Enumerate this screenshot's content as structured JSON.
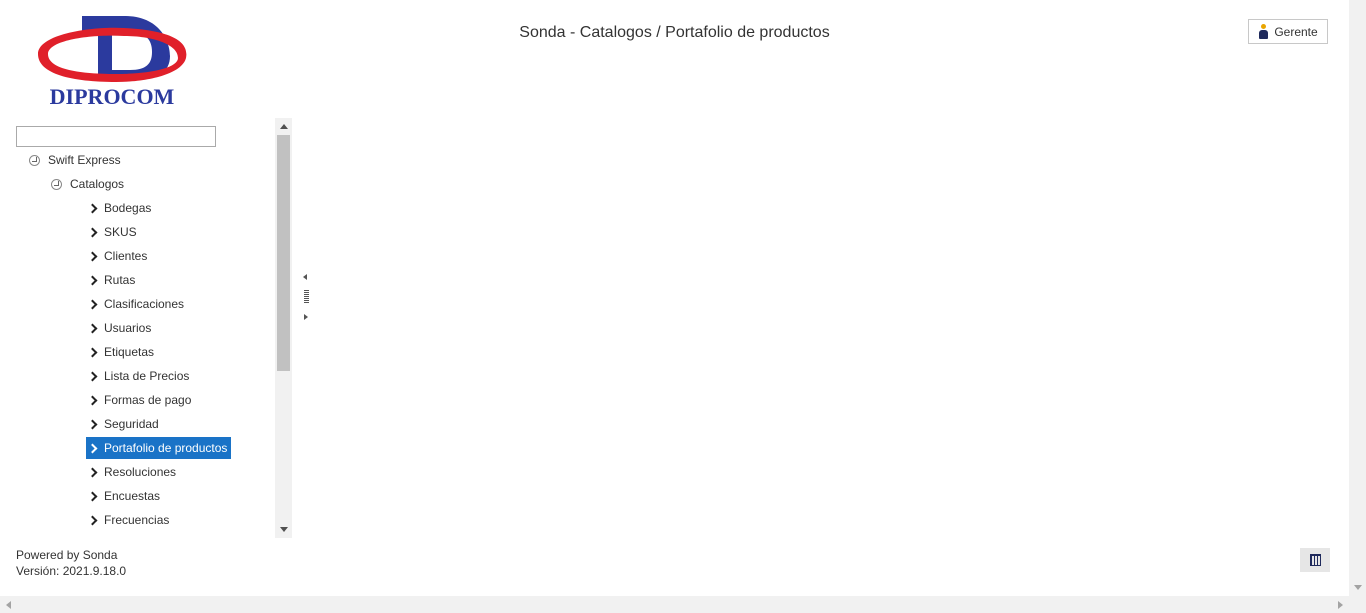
{
  "logo": {
    "text": "DIPROCOM",
    "letter": "D",
    "colors": {
      "primary": "#2b3a9e",
      "ring": "#e0202a"
    }
  },
  "header": {
    "title": "Sonda - Catalogos / Portafolio de productos"
  },
  "user": {
    "label": "Gerente",
    "icon": "user-icon"
  },
  "tree": {
    "search": {
      "value": "",
      "placeholder": ""
    },
    "root": {
      "label": "Swift Express",
      "expanded": true
    },
    "group": {
      "label": "Catalogos",
      "expanded": true
    },
    "items": [
      {
        "label": "Bodegas"
      },
      {
        "label": "SKUS"
      },
      {
        "label": "Clientes"
      },
      {
        "label": "Rutas"
      },
      {
        "label": "Clasificaciones"
      },
      {
        "label": "Usuarios"
      },
      {
        "label": "Etiquetas"
      },
      {
        "label": "Lista de Precios"
      },
      {
        "label": "Formas de pago"
      },
      {
        "label": "Seguridad"
      },
      {
        "label": "Portafolio de productos",
        "selected": true
      },
      {
        "label": "Resoluciones"
      },
      {
        "label": "Encuestas"
      },
      {
        "label": "Frecuencias"
      }
    ],
    "selected_color": "#1a73c7"
  },
  "footer": {
    "powered_by": "Powered by Sonda",
    "version": "Versión: 2021.9.18.0"
  },
  "actions": {
    "trash_icon": "trash-icon"
  }
}
